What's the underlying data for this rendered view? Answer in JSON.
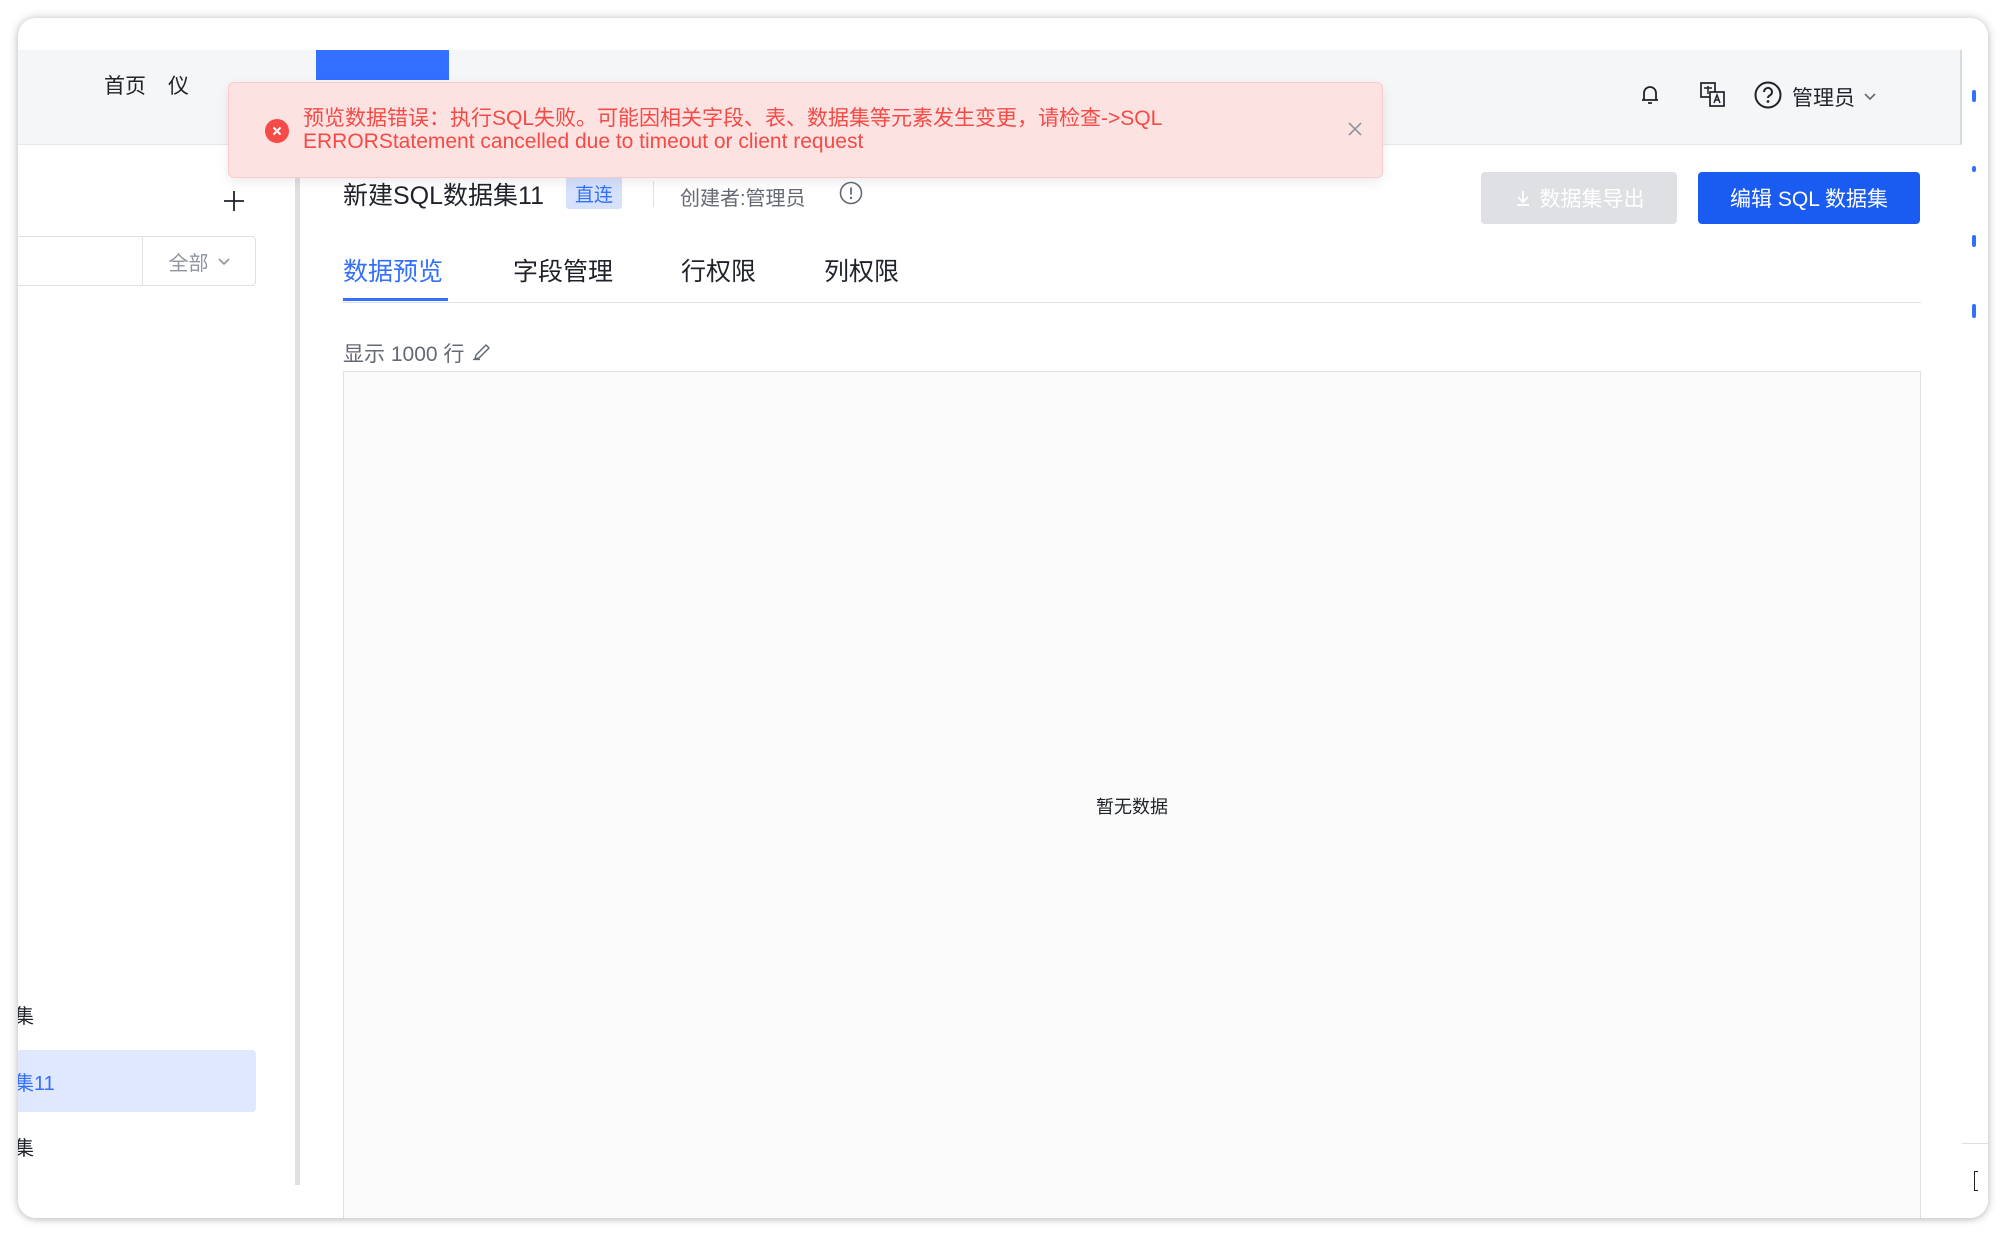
{
  "header": {
    "nav": [
      "首页",
      "仪"
    ],
    "user_label": "管理员"
  },
  "sidebar": {
    "filter_value": "全部",
    "items": [
      {
        "label": "集"
      },
      {
        "label": "集11"
      },
      {
        "label": "集"
      }
    ]
  },
  "dataset": {
    "title": "新建SQL数据集11",
    "mode_tag": "直连",
    "creator": "创建者:管理员",
    "export_label": "数据集导出",
    "edit_label": "编辑 SQL 数据集"
  },
  "tabs": [
    "数据预览",
    "字段管理",
    "行权限",
    "列权限"
  ],
  "preview": {
    "row_limit": "显示 1000 行",
    "empty_text": "暂无数据"
  },
  "alert": {
    "message": "预览数据错误：执行SQL失败。可能因相关字段、表、数据集等元素发生变更，请检查->SQL ERRORStatement cancelled due to timeout or client request"
  },
  "colors": {
    "primary": "#3370ff",
    "error": "#f54a45",
    "alert_bg": "#fde2e2"
  }
}
